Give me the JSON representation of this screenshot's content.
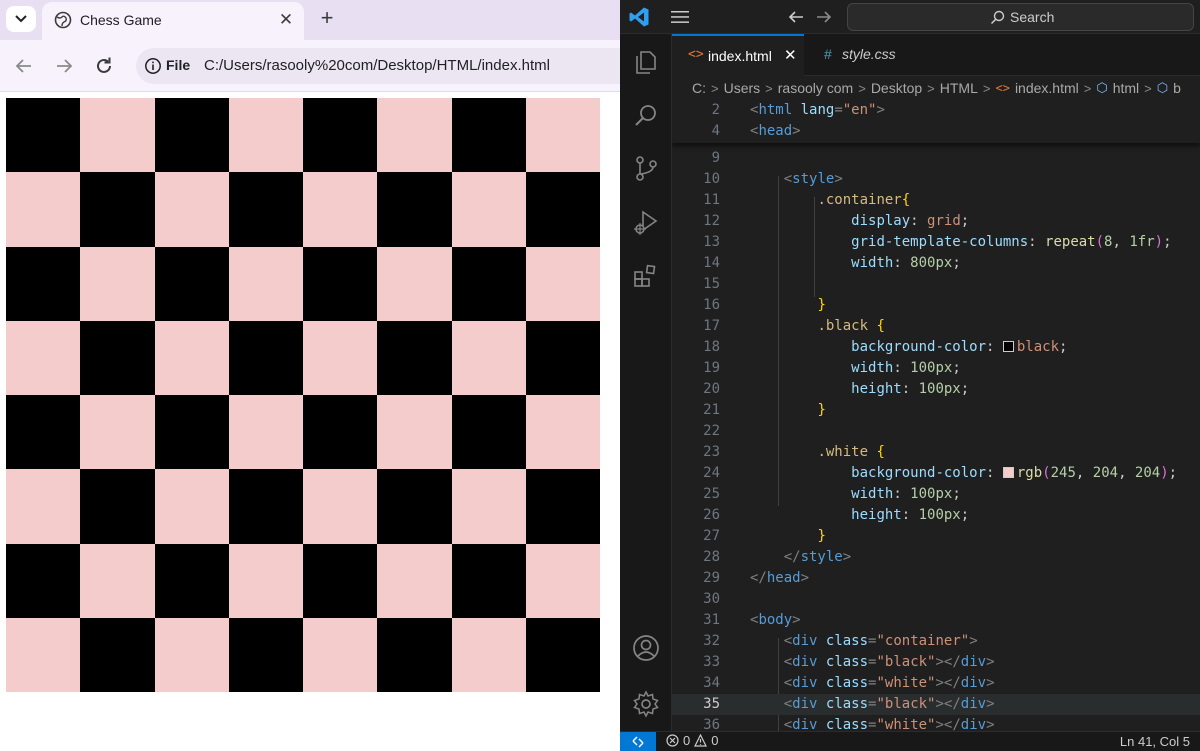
{
  "browser": {
    "tab_title": "Chess Game",
    "address_chip": "File",
    "url": "C:/Users/rasooly%20com/Desktop/HTML/index.html"
  },
  "board": {
    "rows": 8,
    "cols": 8,
    "colors": {
      "black": "#000000",
      "white": "#f5cccc"
    }
  },
  "vscode": {
    "search_label": "Search",
    "tabs": [
      {
        "label": "index.html",
        "icon": "<>",
        "close": "✕"
      },
      {
        "label": "style.css",
        "icon": "#"
      }
    ],
    "breadcrumbs": [
      "C:",
      "Users",
      "rasooly com",
      "Desktop",
      "HTML",
      "index.html",
      "html",
      "b"
    ],
    "accent_color": "#0078d4",
    "status": {
      "errors": "0",
      "warnings": "0",
      "cursor": "Ln 41, Col 5"
    }
  }
}
